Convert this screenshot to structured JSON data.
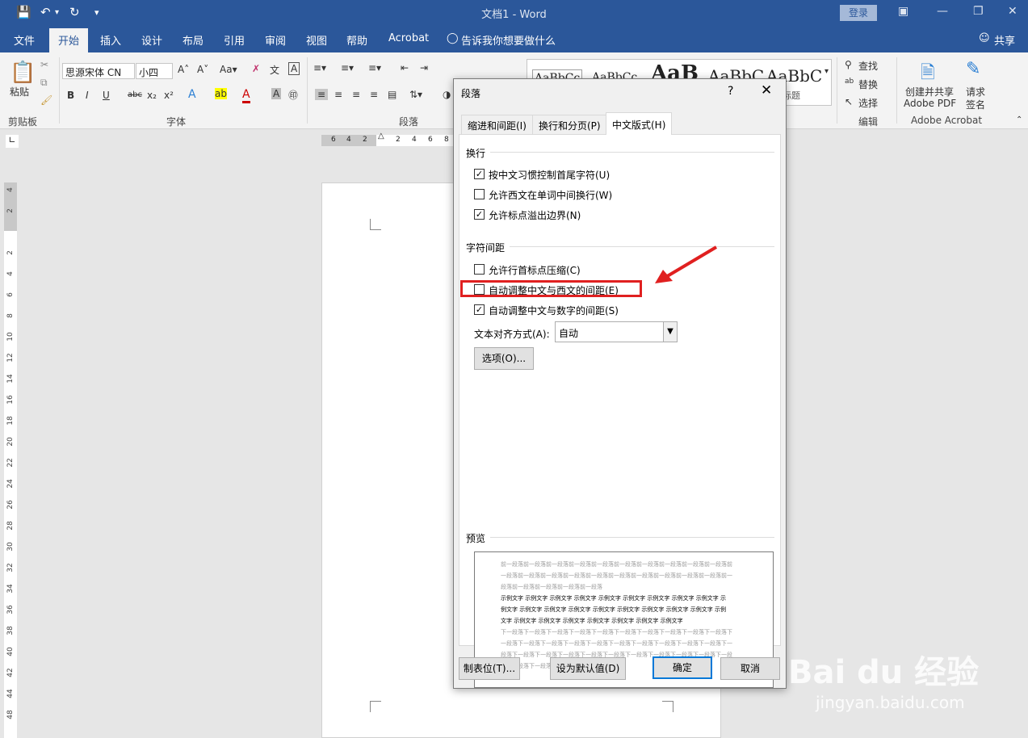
{
  "window": {
    "title": "文档1 - Word",
    "login": "登录"
  },
  "tabs": [
    "文件",
    "开始",
    "插入",
    "设计",
    "布局",
    "引用",
    "审阅",
    "视图",
    "帮助",
    "Acrobat"
  ],
  "tell_me": "告诉我你想要做什么",
  "share": "共享",
  "ribbon": {
    "paste": "粘贴",
    "font_name": "思源宋体 CN",
    "font_size": "小四",
    "groups": {
      "clipboard": "剪贴板",
      "font": "字体",
      "paragraph": "段落",
      "edit": "编辑",
      "acrobat": "Adobe Acrobat"
    },
    "styles": [
      "AaBbCc",
      "AaBbCc",
      "AaB",
      "AaBbC",
      "AaBbC"
    ],
    "style_caption": "标题",
    "find": "查找",
    "replace": "替换",
    "select": "选择",
    "create_pdf_1": "创建并共享",
    "create_pdf_2": "Adobe PDF",
    "sign_1": "请求",
    "sign_2": "签名"
  },
  "ruler": {
    "h_numbers": [
      "6",
      "4",
      "2",
      "2",
      "2",
      "4",
      "6",
      "8"
    ],
    "v_numbers": [
      "4",
      "2",
      "2",
      "4",
      "6",
      "8",
      "10",
      "12",
      "14",
      "16",
      "18",
      "20",
      "22",
      "24",
      "26",
      "28",
      "30",
      "32",
      "34",
      "36",
      "38",
      "40",
      "42",
      "44",
      "48"
    ]
  },
  "dialog": {
    "title": "段落",
    "help": "?",
    "tabs": [
      "缩进和间距(I)",
      "换行和分页(P)",
      "中文版式(H)"
    ],
    "section_line_break": "换行",
    "section_char_spacing": "字符间距",
    "options": [
      {
        "label": "按中文习惯控制首尾字符(U)",
        "checked": true
      },
      {
        "label": "允许西文在单词中间换行(W)",
        "checked": false
      },
      {
        "label": "允许标点溢出边界(N)",
        "checked": true
      },
      {
        "label": "允许行首标点压缩(C)",
        "checked": false
      },
      {
        "label": "自动调整中文与西文的间距(E)",
        "checked": false
      },
      {
        "label": "自动调整中文与数字的间距(S)",
        "checked": true
      }
    ],
    "align_label": "文本对齐方式(A):",
    "align_value": "自动",
    "options_btn": "选项(O)...",
    "preview_label": "预览",
    "preview_prev": [
      "前一段落前一段落前一段落前一段落前一段落前一段落前一段落前一段落前一段落前一段落前",
      "一段落前一段落前一段落前一段落前一段落前一段落前一段落前一段落前一段落前一段落前一",
      "段落前一段落前一段落前一段落前一段落"
    ],
    "preview_sample": [
      "示例文字 示例文字 示例文字 示例文字 示例文字 示例文字 示例文字 示例文字 示例文字 示",
      "例文字 示例文字 示例文字 示例文字 示例文字 示例文字 示例文字 示例文字 示例文字 示例",
      "文字 示例文字 示例文字 示例文字 示例文字 示例文字 示例文字 示例文字"
    ],
    "preview_next": [
      "下一段落下一段落下一段落下一段落下一段落下一段落下一段落下一段落下一段落下一段落下",
      "一段落下一段落下一段落下一段落下一段落下一段落下一段落下一段落下一段落下一段落下一",
      "段落下一段落下一段落下一段落下一段落下一段落下一段落下一段落下一段落下一段落下一段",
      "落下一段落下一段落下一段落"
    ],
    "btn_tabs": "制表位(T)...",
    "btn_default": "设为默认值(D)",
    "btn_ok": "确定",
    "btn_cancel": "取消"
  },
  "watermark": {
    "main": "Bai du 经验",
    "url": "jingyan.baidu.com"
  },
  "colors": {
    "word_blue": "#2b579a",
    "highlight_red": "#e02020"
  }
}
